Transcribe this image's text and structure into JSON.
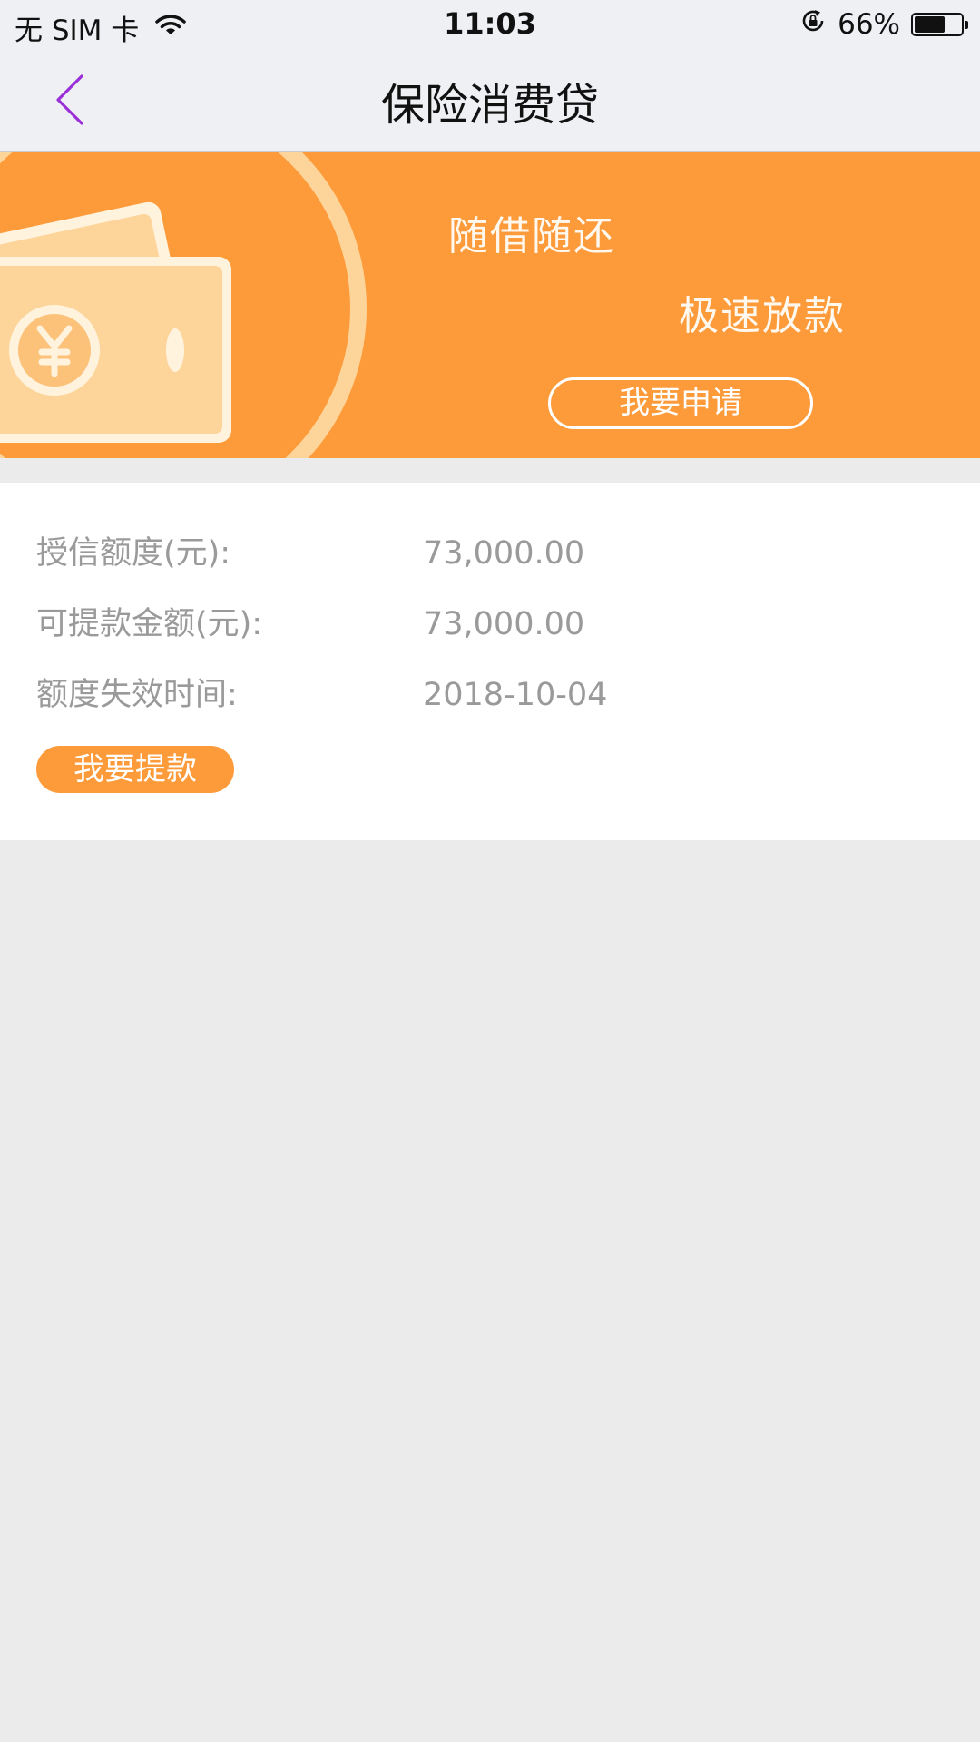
{
  "status_bar": {
    "carrier": "无 SIM 卡",
    "time": "11:03",
    "battery_percent": "66%",
    "battery_level": 0.66,
    "icons": [
      "wifi-icon",
      "rotation-lock-icon",
      "battery-icon"
    ]
  },
  "nav": {
    "title": "保险消费贷",
    "back_icon": "chevron-left-icon",
    "accent_color": "#9b30d9"
  },
  "banner": {
    "slogan_1": "随借随还",
    "slogan_2": "极速放款",
    "apply_label": "我要申请",
    "background_color": "#fd9a3a",
    "illustration": "banknote-yen-icon"
  },
  "info": {
    "rows": [
      {
        "label": "授信额度(元):",
        "value": "73,000.00"
      },
      {
        "label": "可提款金额(元):",
        "value": "73,000.00"
      },
      {
        "label": "额度失效时间:",
        "value": "2018-10-04"
      }
    ],
    "withdraw_label": "我要提款"
  }
}
